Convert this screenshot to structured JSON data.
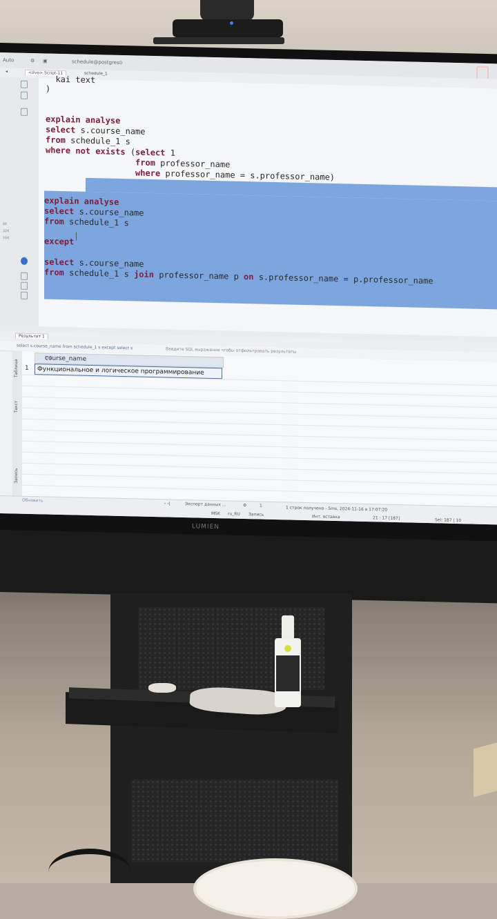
{
  "toolbar": {
    "auto_label": "Auto",
    "db_label": "schedule@postgres"
  },
  "tabs": [
    {
      "label": "<dvo> Script-11"
    },
    {
      "label": "schedule_1"
    }
  ],
  "gutter": {
    "numbers": [
      "6K",
      "32K",
      "16K"
    ]
  },
  "editor": {
    "lines_unselected": [
      "  kai text",
      ")",
      "explain analyse",
      "select s.course_name",
      "from schedule_1 s",
      "where not exists (select 1",
      "                  from professor_name",
      "                  where professor_name = s.professor_name)"
    ],
    "lines_selected": [
      "explain analyse",
      "select s.course_name",
      "from schedule_1 s",
      "except",
      "select s.course_name",
      "from schedule_1 s join professor_name p on s.professor_name = p.professor_name"
    ]
  },
  "results": {
    "tab_label": "Результат 1",
    "filter_query": "select s.course_name from schedule_1 s except select s",
    "filter_placeholder": "Введите SQL выражение чтобы отфильтровать результаты",
    "sidebar_labels": [
      "Таблица",
      "Текст",
      "Запись"
    ],
    "column_header": "course_name",
    "rows": [
      {
        "num": "1",
        "value": "Функциональное и логическое программирование"
      }
    ]
  },
  "status": {
    "refresh_label": "Обновить",
    "export_label": "Экспорт данных ...",
    "count_label": "1",
    "rows_info": "1 строк получено - 5ms, 2024-11-16 в 17:07:20",
    "tz": "MSK",
    "locale": "ru_RU",
    "mode": "Запись",
    "insert_mode": "Инт. вставка",
    "position": "21 : 17 [187]",
    "selection": "Sel: 187 | 10"
  },
  "monitor": {
    "brand": "LUMIEN"
  }
}
